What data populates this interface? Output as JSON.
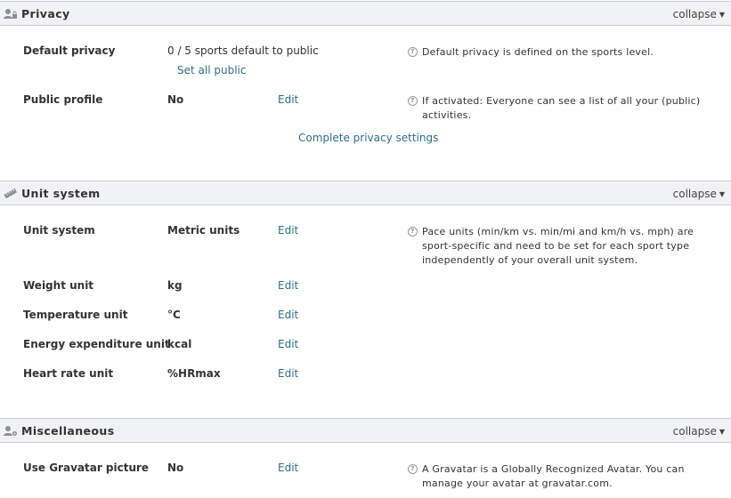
{
  "sections": {
    "privacy": {
      "title": "Privacy",
      "collapse": "collapse",
      "default_privacy": {
        "label": "Default privacy",
        "value": "0 / 5 sports default to public",
        "action": "Set all public",
        "hint": "Default privacy is defined on the sports level."
      },
      "public_profile": {
        "label": "Public profile",
        "value": "No",
        "edit": "Edit",
        "hint": "If activated: Everyone can see a list of all your (public) activities."
      },
      "complete_link": "Complete privacy settings"
    },
    "unit_system": {
      "title": "Unit system",
      "collapse": "collapse",
      "rows": [
        {
          "label": "Unit system",
          "value": "Metric units",
          "edit": "Edit",
          "hint": "Pace units (min/km vs. min/mi and km/h vs. mph) are sport-specific and need to be set for each sport type independently of your overall unit system."
        },
        {
          "label": "Weight unit",
          "value": "kg",
          "edit": "Edit"
        },
        {
          "label": "Temperature unit",
          "value": "°C",
          "edit": "Edit"
        },
        {
          "label": "Energy expenditure unit",
          "value": "kcal",
          "edit": "Edit"
        },
        {
          "label": "Heart rate unit",
          "value": "%HRmax",
          "edit": "Edit"
        }
      ]
    },
    "misc": {
      "title": "Miscellaneous",
      "collapse": "collapse",
      "gravatar": {
        "label": "Use Gravatar picture",
        "value": "No",
        "edit": "Edit",
        "hint": "A Gravatar is a Globally Recognized Avatar. You can manage your avatar at gravatar.com."
      }
    }
  },
  "colors": {
    "link": "#2e6f85",
    "header_bg": "#f1f2f3",
    "header_border": "#c9cdd1",
    "text": "#333333"
  },
  "icons": {
    "privacy": "user-lock-icon",
    "unit_system": "ruler-icon",
    "misc": "user-gear-icon",
    "hint": "question-circle-icon",
    "collapse": "caret-down-icon"
  }
}
